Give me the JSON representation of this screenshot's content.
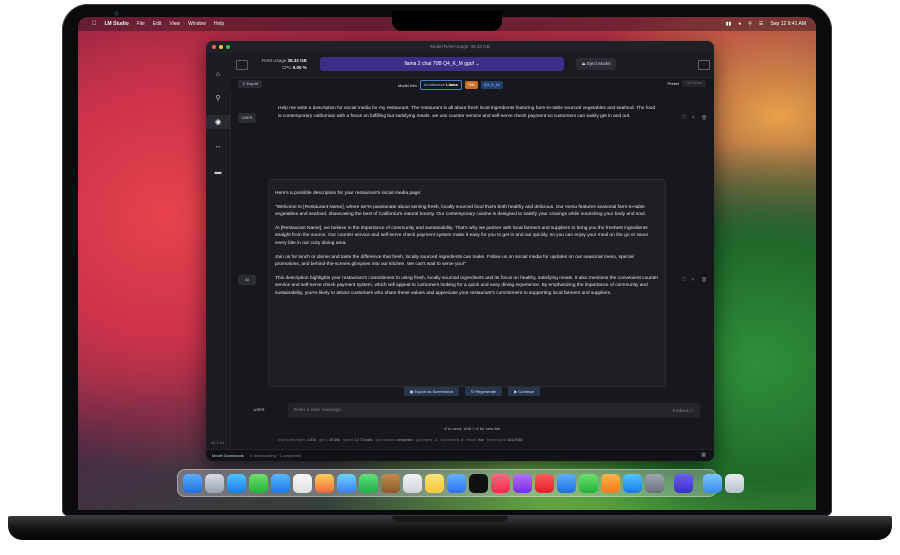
{
  "menubar": {
    "app": "LM Studio",
    "items": [
      "File",
      "Edit",
      "View",
      "Window",
      "Help"
    ],
    "datetime": "Sep 12  9:41 AM"
  },
  "window": {
    "title": "Model RAM Usage: 38.33 GB",
    "version": "v0.2.14"
  },
  "topbar": {
    "ram_label": "RAM Usage",
    "ram_value": "38.33 GB",
    "cpu_label": "CPU",
    "cpu_value": "9.00 %",
    "model": "llama 2 chat 70B Q4_K_M gguf",
    "eject": "Eject Model"
  },
  "infobar": {
    "export": "Export",
    "model_info": "Model Info",
    "architecture_label": "Architecture",
    "architecture": "Llama",
    "size": "70B",
    "quant": "Q4_K_M",
    "preset_label": "Preset",
    "preset_value": "No Preset"
  },
  "chat": {
    "user_role": "USER",
    "ai_role": "AI",
    "user_message": "Help me write a description for social media for my restaurant. The restaurant is all about fresh local ingredients featuring farm-to-table sourced vegetables and seafood. The food is contemporary californian with a focus on fulfilling but satisfying meals. we use counter service and self-serve check payment so customers can easily get in and out.",
    "ai_paragraphs": [
      "Here's a possible description for your restaurant's social media page:",
      "\"Welcome to [Restaurant Name], where we're passionate about serving fresh, locally sourced food that's both healthy and delicious. Our menu features seasonal farm-to-table vegetables and seafood, showcasing the best of California's natural bounty. Our contemporary cuisine is designed to satisfy your cravings while nourishing your body and soul.",
      "At [Restaurant Name], we believe in the importance of community and sustainability. That's why we partner with local farmers and suppliers to bring you the freshest ingredients straight from the source. Our counter service and self-serve check payment system make it easy for you to get in and out quickly, so you can enjoy your meal on the go or savor every bite in our cozy dining area.",
      "Join us for lunch or dinner and taste the difference that fresh, locally sourced ingredients can make. Follow us on social media for updates on our seasonal menu, special promotions, and behind-the-scenes glimpses into our kitchen. We can't wait to serve you!\"",
      "This description highlights your restaurant's commitment to using fresh, locally sourced ingredients and its focus on healthy, satisfying meals. It also mentions the convenient counter service and self-serve check payment system, which will appeal to customers looking for a quick and easy dining experience. By emphasizing the importance of community and sustainability, you're likely to attract customers who share these values and appreciate your restaurant's commitment to supporting local farmers and suppliers."
    ]
  },
  "actions": {
    "export_screenshot": "Export as Screenshot",
    "regenerate": "Regenerate",
    "continue": "Continue"
  },
  "input": {
    "role": "USER",
    "placeholder": "Enter a user message...",
    "tokens": "0 tokens",
    "hint": "⏎ to send, shift + ⏎ for new line"
  },
  "stats": {
    "time_to_first_token_label": "time to first token:",
    "time_to_first_token": "2.87s",
    "gen_t_label": "gen t:",
    "gen_t": "29.36s",
    "speed_label": "speed:",
    "speed": "12.70 tok/s",
    "stop_reason_label": "stop reason:",
    "stop_reason": "completed",
    "gpu_layers_label": "gpu layers:",
    "gpu_layers": "-1",
    "cpu_threads_label": "cpu threads:",
    "cpu_threads": "4",
    "mlock_label": "mlock:",
    "mlock": "true",
    "token_count_label": "token count:",
    "token_count": "461/2048"
  },
  "statusbar": {
    "downloads": "Model Downloads",
    "downloads_status": "0 downloading · 1 completed"
  },
  "colors": {
    "accent": "#3a2f86",
    "window_bg": "#17181c",
    "size_badge": "#c7702a"
  }
}
